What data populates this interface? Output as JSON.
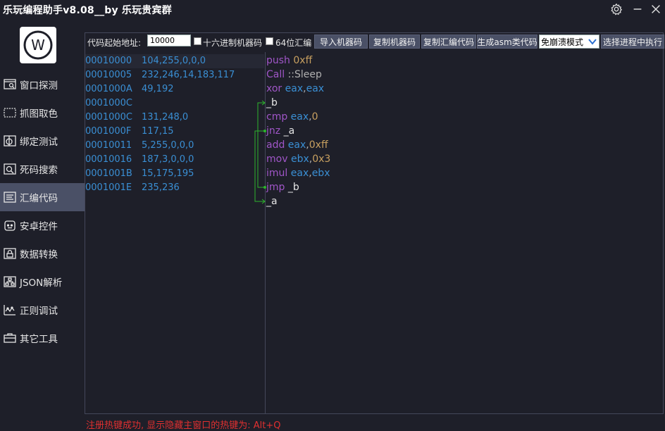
{
  "window": {
    "title": "乐玩编程助手v8.08__by 乐玩贵宾群"
  },
  "sidebar": {
    "logo": "W",
    "items": [
      {
        "label": "窗口探测",
        "icon": "window-probe-icon"
      },
      {
        "label": "抓图取色",
        "icon": "capture-icon"
      },
      {
        "label": "绑定测试",
        "icon": "bind-test-icon"
      },
      {
        "label": "死码搜索",
        "icon": "search-icon"
      },
      {
        "label": "汇编代码",
        "icon": "assembly-icon"
      },
      {
        "label": "安卓控件",
        "icon": "android-icon"
      },
      {
        "label": "数据转换",
        "icon": "lock-icon"
      },
      {
        "label": "JSON解析",
        "icon": "tree-icon"
      },
      {
        "label": "正则调试",
        "icon": "regex-icon"
      },
      {
        "label": "其它工具",
        "icon": "toolbox-icon"
      }
    ],
    "active_index": 4
  },
  "toolbar": {
    "start_addr_label": "代码起始地址:",
    "start_addr_value": "10000",
    "hex_machine_label": "十六进制机器码",
    "bit64_label": "64位汇编",
    "import_btn": "导入机器码",
    "copy_machine_btn": "复制机器码",
    "copy_asm_btn": "复制汇编代码",
    "gen_asm_class_btn": "生成asm类代码",
    "mode_select": "免崩溃模式",
    "exec_btn": "选择进程中执行"
  },
  "hex_rows": [
    {
      "addr": "00010000",
      "bytes": "104,255,0,0,0"
    },
    {
      "addr": "00010005",
      "bytes": "232,246,14,183,117"
    },
    {
      "addr": "0001000A",
      "bytes": "49,192"
    },
    {
      "addr": "0001000C",
      "bytes": ""
    },
    {
      "addr": "0001000C",
      "bytes": "131,248,0"
    },
    {
      "addr": "0001000F",
      "bytes": "117,15"
    },
    {
      "addr": "00010011",
      "bytes": "5,255,0,0,0"
    },
    {
      "addr": "00010016",
      "bytes": "187,3,0,0,0"
    },
    {
      "addr": "0001001B",
      "bytes": "15,175,195"
    },
    {
      "addr": "0001001E",
      "bytes": "235,236"
    }
  ],
  "asm_rows": [
    {
      "op": "push",
      "args": [
        {
          "t": "num",
          "v": " 0xff"
        }
      ]
    },
    {
      "op": "Call",
      "args": [
        {
          "t": "sym",
          "v": " ::Sleep"
        }
      ]
    },
    {
      "op": "xor",
      "args": [
        {
          "t": "reg",
          "v": " eax"
        },
        {
          "t": "sym",
          "v": ","
        },
        {
          "t": "reg",
          "v": "eax"
        }
      ]
    },
    {
      "op": "",
      "args": [
        {
          "t": "lbl",
          "v": "_b"
        }
      ]
    },
    {
      "op": "cmp",
      "args": [
        {
          "t": "reg",
          "v": " eax"
        },
        {
          "t": "sym",
          "v": ","
        },
        {
          "t": "num",
          "v": "0"
        }
      ]
    },
    {
      "op": "jnz",
      "args": [
        {
          "t": "lbl",
          "v": " _a"
        }
      ]
    },
    {
      "op": "add",
      "args": [
        {
          "t": "reg",
          "v": " eax"
        },
        {
          "t": "sym",
          "v": ","
        },
        {
          "t": "num",
          "v": "0xff"
        }
      ]
    },
    {
      "op": "mov",
      "args": [
        {
          "t": "reg",
          "v": " ebx"
        },
        {
          "t": "sym",
          "v": ","
        },
        {
          "t": "num",
          "v": "0x3"
        }
      ]
    },
    {
      "op": "imul",
      "args": [
        {
          "t": "reg",
          "v": " eax"
        },
        {
          "t": "sym",
          "v": ","
        },
        {
          "t": "reg",
          "v": "ebx"
        }
      ]
    },
    {
      "op": "jmp",
      "args": [
        {
          "t": "lbl",
          "v": " _b"
        }
      ]
    },
    {
      "op": "",
      "args": [
        {
          "t": "lbl",
          "v": "_a"
        }
      ]
    }
  ],
  "status": "注册热键成功, 显示隐藏主窗口的热键为: Alt+Q",
  "colors": {
    "background": "#1e1f29",
    "active_nav": "#4a5066",
    "address": "#3a8fd4",
    "keyword": "#a056c8",
    "number": "#c8a060",
    "status": "#e03030",
    "arrow": "#2db52d"
  }
}
